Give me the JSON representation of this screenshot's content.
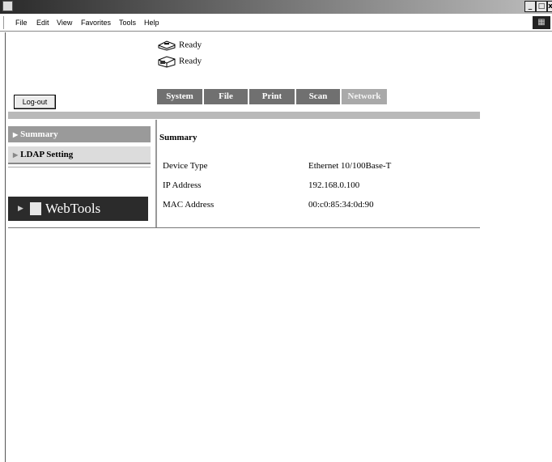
{
  "menu": [
    "File",
    "Edit",
    "View",
    "Favorites",
    "Tools",
    "Help"
  ],
  "status": [
    {
      "icon": "printer-icon",
      "text": "Ready"
    },
    {
      "icon": "scanner-icon",
      "text": "Ready"
    }
  ],
  "logout_label": "Log-out",
  "tabs": [
    {
      "label": "System",
      "active": false
    },
    {
      "label": "File",
      "active": false
    },
    {
      "label": "Print",
      "active": false
    },
    {
      "label": "Scan",
      "active": false
    },
    {
      "label": "Network",
      "active": true
    }
  ],
  "sidebar": {
    "items": [
      {
        "label": "Summary",
        "selected": true
      },
      {
        "label": "LDAP Setting",
        "selected": false
      }
    ],
    "webtools_label": "WebTools"
  },
  "summary": {
    "title": "Summary",
    "rows": [
      {
        "label": "Device Type",
        "value": "Ethernet 10/100Base-T"
      },
      {
        "label": "IP Address",
        "value": "192.168.0.100"
      },
      {
        "label": "MAC Address",
        "value": "00:c0:85:34:0d:90"
      }
    ]
  },
  "colors": {
    "tab_bg": "#707070",
    "tab_active_bg": "#a9a9a9",
    "sidebar_selected": "#9a9a9a",
    "webtools_bg": "#2b2b2b"
  }
}
